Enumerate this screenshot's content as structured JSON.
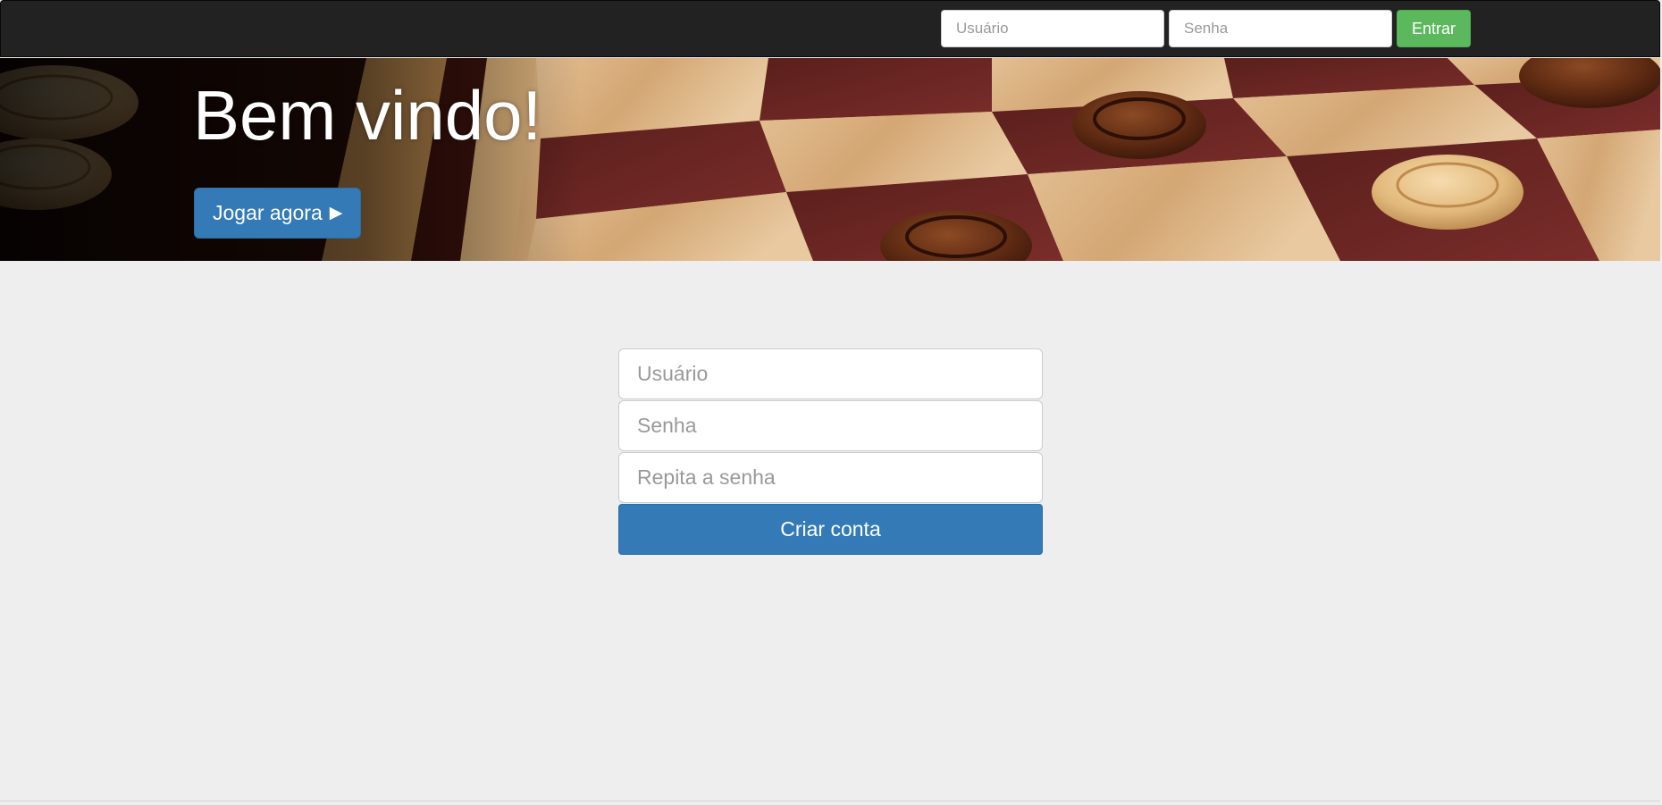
{
  "navbar": {
    "username_placeholder": "Usuário",
    "password_placeholder": "Senha",
    "login_label": "Entrar"
  },
  "hero": {
    "title": "Bem vindo!",
    "play_label": "Jogar agora",
    "play_icon": "▶",
    "image": "checkers-board-photo"
  },
  "signup": {
    "username_placeholder": "Usuário",
    "password_placeholder": "Senha",
    "repeat_password_placeholder": "Repita a senha",
    "submit_label": "Criar conta"
  },
  "colors": {
    "navbar_bg": "#222222",
    "page_bg": "#eeeeee",
    "primary": "#337ab7",
    "success": "#5cb85c"
  }
}
